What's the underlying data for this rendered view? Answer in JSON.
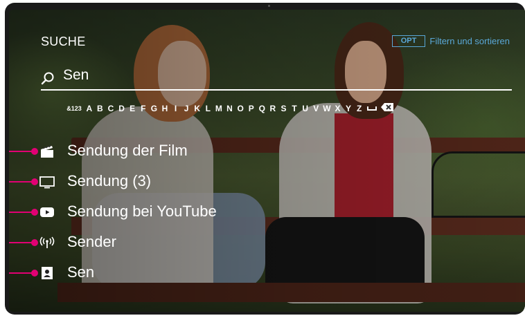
{
  "screen": {
    "title": "SUCHE",
    "options": {
      "key": "OPT",
      "label": "Filtern und sortieren"
    },
    "search": {
      "query": "Sen",
      "icon": "search-icon"
    },
    "keyboard": {
      "symbols_key": "&123",
      "letters": [
        "A",
        "B",
        "C",
        "D",
        "E",
        "F",
        "G",
        "H",
        "I",
        "J",
        "K",
        "L",
        "M",
        "N",
        "O",
        "P",
        "Q",
        "R",
        "S",
        "T",
        "U",
        "V",
        "W",
        "X",
        "Y",
        "Z"
      ],
      "space_icon": "space-icon",
      "backspace_icon": "backspace-icon"
    },
    "results": [
      {
        "icon": "film-clapper-icon",
        "label": "Sendung der Film"
      },
      {
        "icon": "tv-icon",
        "label": "Sendung (3)"
      },
      {
        "icon": "youtube-icon",
        "label": "Sendung bei YouTube"
      },
      {
        "icon": "broadcast-icon",
        "label": "Sender"
      },
      {
        "icon": "contact-icon",
        "label": "Sen"
      }
    ],
    "accent_color": "#e20074",
    "opt_color": "#5aa8d8"
  }
}
